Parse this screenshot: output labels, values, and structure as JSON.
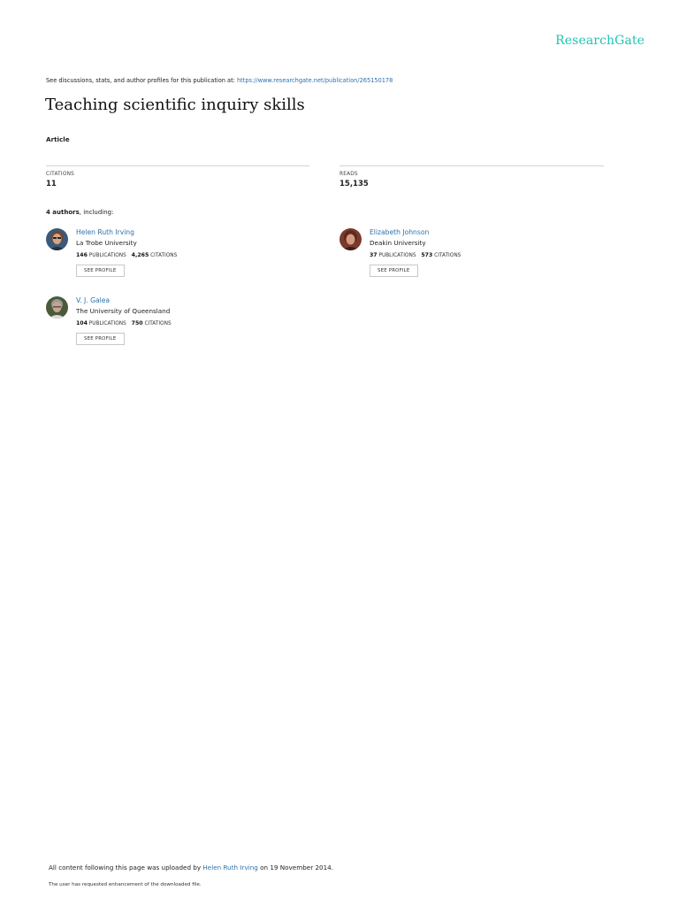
{
  "brand": {
    "name": "ResearchGate",
    "color": "#20c4b3"
  },
  "header": {
    "discussion_prefix": "See discussions, stats, and author profiles for this publication at: ",
    "publication_url": "https://www.researchgate.net/publication/265150178"
  },
  "publication": {
    "title": "Teaching scientific inquiry skills",
    "type": "Article"
  },
  "stats": {
    "citations_label": "CITATIONS",
    "citations_value": "11",
    "reads_label": "READS",
    "reads_value": "15,135"
  },
  "authors_summary": {
    "count": "4 authors",
    "suffix": ", including:"
  },
  "authors": [
    {
      "name": "Helen Ruth Irving",
      "institution": "La Trobe University",
      "publications": "146",
      "publications_label": "PUBLICATIONS",
      "citations": "4,265",
      "citations_label": "CITATIONS",
      "button": "SEE PROFILE"
    },
    {
      "name": "Elizabeth Johnson",
      "institution": "Deakin University",
      "publications": "37",
      "publications_label": "PUBLICATIONS",
      "citations": "573",
      "citations_label": "CITATIONS",
      "button": "SEE PROFILE"
    },
    {
      "name": "V. J. Galea",
      "institution": "The University of Queensland",
      "publications": "104",
      "publications_label": "PUBLICATIONS",
      "citations": "750",
      "citations_label": "CITATIONS",
      "button": "SEE PROFILE"
    }
  ],
  "footer": {
    "upload_prefix": "All content following this page was uploaded by ",
    "uploader": "Helen Ruth Irving",
    "upload_suffix": " on 19 November 2014.",
    "note": "The user has requested enhancement of the downloaded file."
  },
  "colors": {
    "link": "#2d71ad",
    "divider": "#d4d4d4"
  }
}
